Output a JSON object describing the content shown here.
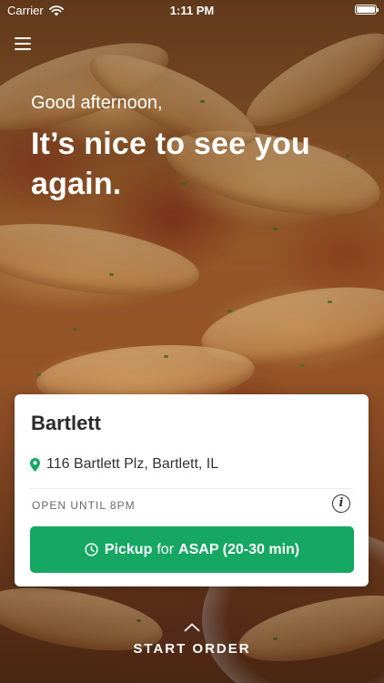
{
  "status_bar": {
    "carrier": "Carrier",
    "time": "1:11 PM"
  },
  "nav": {
    "menu_icon": "hamburger-menu-icon"
  },
  "hero": {
    "greeting": "Good afternoon,",
    "headline": "It’s nice to see you again."
  },
  "store_card": {
    "name": "Bartlett",
    "address": "116 Bartlett Plz, Bartlett, IL",
    "hours": "OPEN UNTIL 8PM",
    "pickup_button": {
      "mode": "Pickup",
      "connector": "for",
      "time": "ASAP (20-30 min)"
    }
  },
  "footer": {
    "start_order_label": "START ORDER"
  },
  "colors": {
    "accent_green": "#16a863",
    "pin_green": "#16a863",
    "card_background": "#ffffff"
  }
}
